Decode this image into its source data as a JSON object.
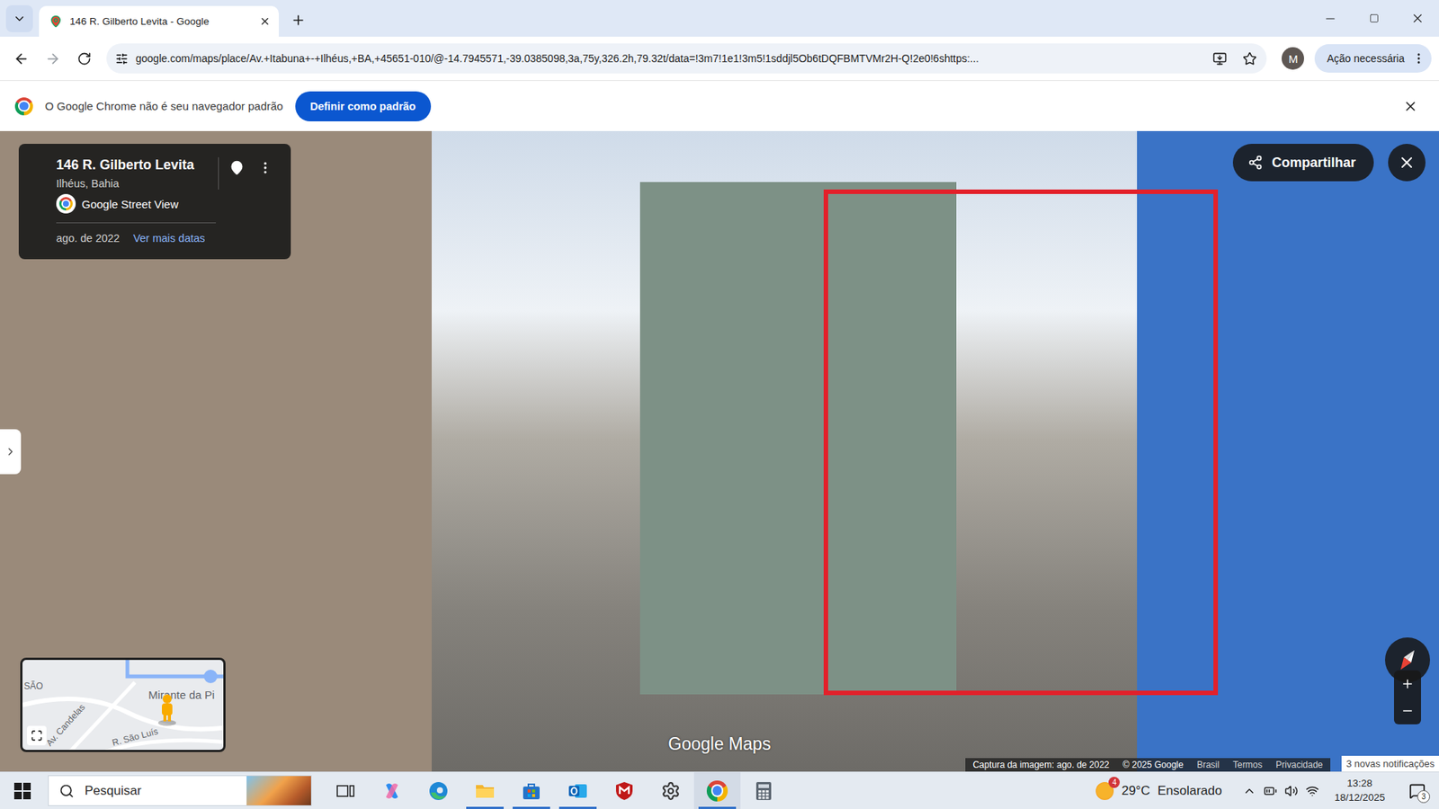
{
  "browser": {
    "tabs": [
      {
        "label": "146 R. Gilberto Levita - Google",
        "selected": true
      }
    ],
    "url": "google.com/maps/place/Av.+Itabuna+-+Ilhéus,+BA,+45651-010/@-14.7945571,-39.0385098,3a,75y,326.2h,79.32t/data=!3m7!1e1!3m5!1sddjl5Ob6tDQFBMTVMr2H-Q!2e0!6shttps:...",
    "profile_initial": "M",
    "action_button": "Ação necessária"
  },
  "infobar": {
    "message": "O Google Chrome não é seu navegador padrão",
    "button": "Definir como padrão"
  },
  "street_view": {
    "place": {
      "title": "146 R. Gilberto Levita",
      "subtitle": "Ilhéus, Bahia",
      "source": "Google Street View",
      "date": "ago. de 2022",
      "more_dates": "Ver mais datas"
    },
    "share_button": "Compartilhar",
    "watermark": "Google Maps",
    "minimap_labels": [
      "SÃO",
      "Av. Candelas",
      "Mirante da Pi",
      "R. São Luís"
    ],
    "footer": [
      "Captura da imagem: ago. de 2022",
      "© 2025 Google",
      "Brasil",
      "Termos",
      "Privacidade"
    ],
    "toast": "3 novas notificações"
  },
  "taskbar": {
    "search_placeholder": "Pesquisar",
    "apps": [
      {
        "kind": "task-view",
        "running": false,
        "active": false
      },
      {
        "kind": "copilot",
        "running": false,
        "active": false
      },
      {
        "kind": "edge",
        "running": false,
        "active": false
      },
      {
        "kind": "explorer",
        "running": true,
        "active": false
      },
      {
        "kind": "store",
        "running": true,
        "active": false
      },
      {
        "kind": "outlook",
        "running": true,
        "active": false
      },
      {
        "kind": "mcafee",
        "running": false,
        "active": false
      },
      {
        "kind": "settings",
        "running": false,
        "active": false
      },
      {
        "kind": "chrome",
        "running": true,
        "active": true
      },
      {
        "kind": "calculator",
        "running": false,
        "active": false
      }
    ],
    "weather": {
      "badge": "4",
      "temperature": "29°C",
      "condition": "Ensolarado"
    },
    "time": "13:28",
    "date": "18/12/2025",
    "notification_count": "3"
  }
}
